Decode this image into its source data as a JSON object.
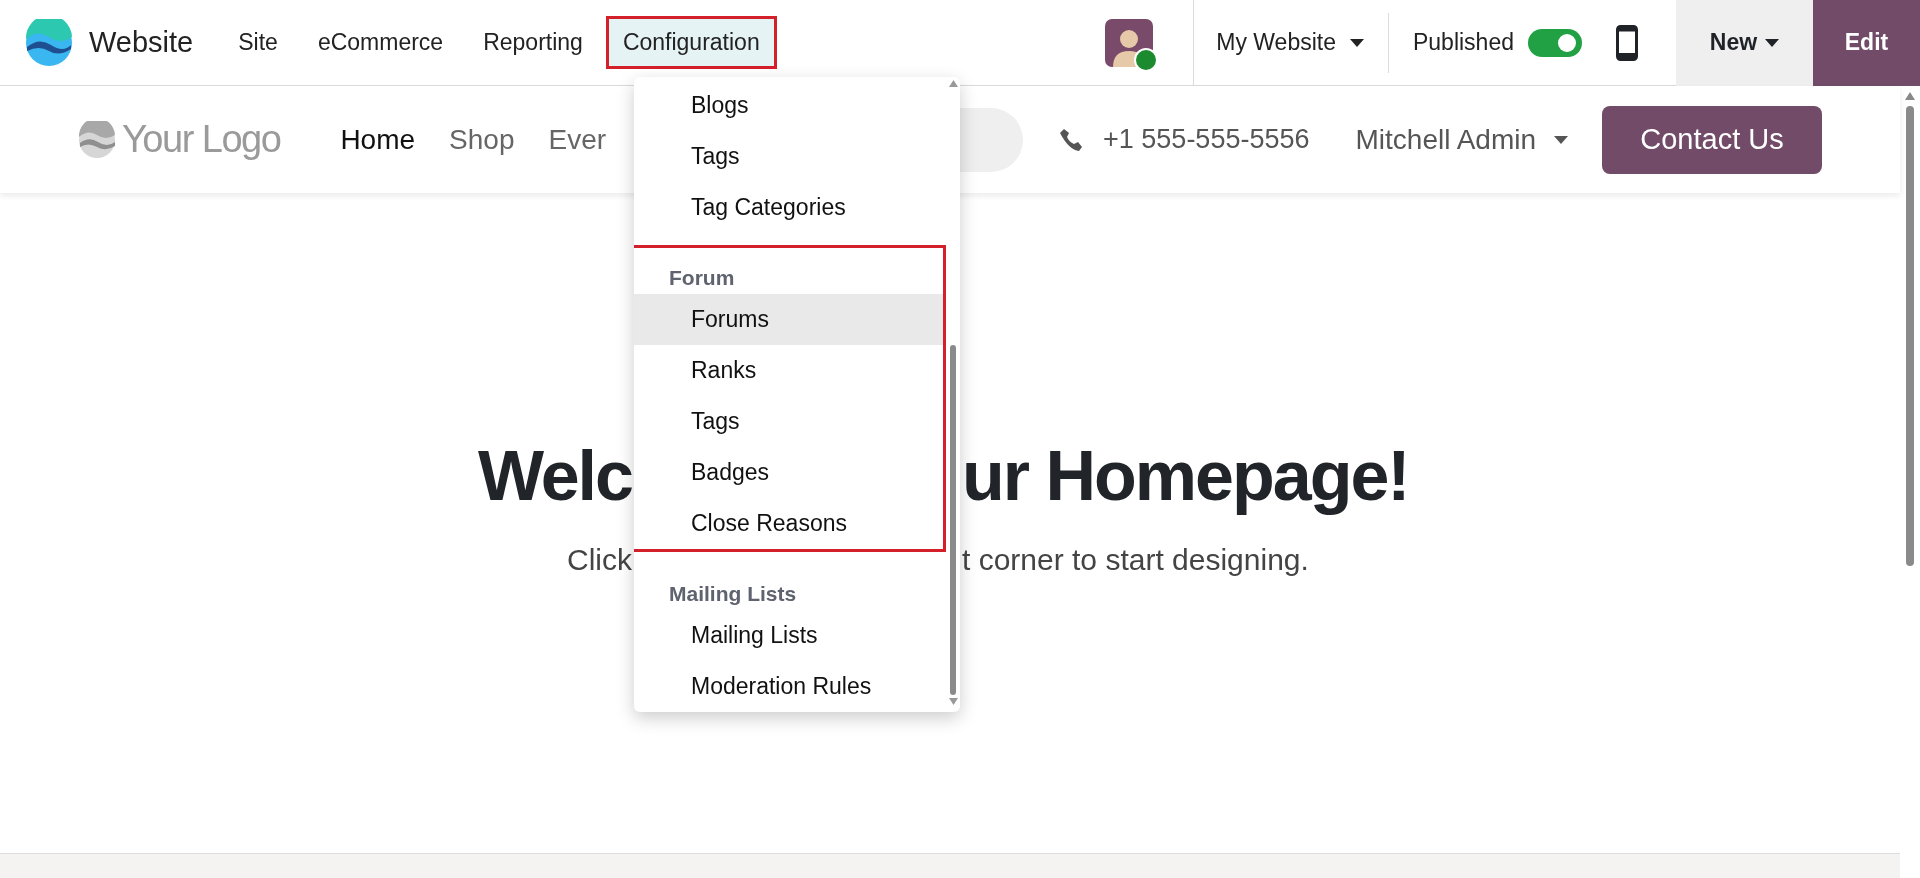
{
  "app_bar": {
    "app_name": "Website",
    "menus": [
      {
        "label": "Site",
        "selected": false,
        "highlighted": false
      },
      {
        "label": "eCommerce",
        "selected": false,
        "highlighted": false
      },
      {
        "label": "Reporting",
        "selected": false,
        "highlighted": false
      },
      {
        "label": "Configuration",
        "selected": true,
        "highlighted": true
      }
    ],
    "website_selector": "My Website",
    "published": {
      "label": "Published",
      "on": true
    },
    "new_button": "New",
    "edit_button": "Edit"
  },
  "site_header": {
    "logo_text": "Your Logo",
    "nav": [
      {
        "label": "Home",
        "selected": true
      },
      {
        "label": "Shop",
        "selected": false
      },
      {
        "label": "Ever",
        "selected": false
      }
    ],
    "phone": "+1 555-555-5556",
    "user": "Mitchell Admin",
    "contact_button": "Contact Us"
  },
  "hero": {
    "title_left": "Welc",
    "title_right": "ur **Homepage!**",
    "subtitle_left": "Click",
    "subtitle_right": "t corner to start designing."
  },
  "config_menu": {
    "sections": [
      {
        "highlighted": false,
        "items": [
          {
            "label": "Blogs",
            "selected": false
          },
          {
            "label": "Tags",
            "selected": false
          },
          {
            "label": "Tag Categories",
            "selected": false
          }
        ]
      },
      {
        "header": "Forum",
        "highlighted": true,
        "items": [
          {
            "label": "Forums",
            "selected": true
          },
          {
            "label": "Ranks",
            "selected": false
          },
          {
            "label": "Tags",
            "selected": false
          },
          {
            "label": "Badges",
            "selected": false
          },
          {
            "label": "Close Reasons",
            "selected": false
          }
        ]
      },
      {
        "header": "Mailing Lists",
        "highlighted": false,
        "items": [
          {
            "label": "Mailing Lists",
            "selected": false
          },
          {
            "label": "Moderation Rules",
            "selected": false
          }
        ]
      }
    ]
  }
}
